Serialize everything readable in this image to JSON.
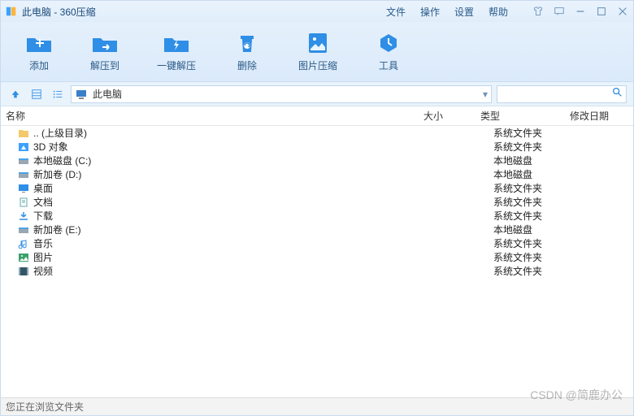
{
  "title": "此电脑 - 360压缩",
  "menu": {
    "file": "文件",
    "action": "操作",
    "settings": "设置",
    "help": "帮助"
  },
  "toolbar": {
    "add": "添加",
    "extract_to": "解压到",
    "one_key": "一键解压",
    "delete": "删除",
    "image_compress": "图片压缩",
    "tools": "工具"
  },
  "path": {
    "label": "此电脑"
  },
  "columns": {
    "name": "名称",
    "size": "大小",
    "type": "类型",
    "date": "修改日期"
  },
  "type_strings": {
    "sys_folder": "系统文件夹",
    "local_disk": "本地磁盘"
  },
  "rows": [
    {
      "name": ".. (上级目录)",
      "type": "系统文件夹",
      "icon": "folder"
    },
    {
      "name": "3D 对象",
      "type": "系统文件夹",
      "icon": "obj3d"
    },
    {
      "name": "本地磁盘 (C:)",
      "type": "本地磁盘",
      "icon": "disk"
    },
    {
      "name": "新加卷 (D:)",
      "type": "本地磁盘",
      "icon": "disk"
    },
    {
      "name": "桌面",
      "type": "系统文件夹",
      "icon": "desktop"
    },
    {
      "name": "文档",
      "type": "系统文件夹",
      "icon": "doc"
    },
    {
      "name": "下载",
      "type": "系统文件夹",
      "icon": "download"
    },
    {
      "name": "新加卷 (E:)",
      "type": "本地磁盘",
      "icon": "disk"
    },
    {
      "name": "音乐",
      "type": "系统文件夹",
      "icon": "music"
    },
    {
      "name": "图片",
      "type": "系统文件夹",
      "icon": "picture"
    },
    {
      "name": "视频",
      "type": "系统文件夹",
      "icon": "video"
    }
  ],
  "status": "您正在浏览文件夹",
  "watermark": "CSDN @简鹿办公"
}
